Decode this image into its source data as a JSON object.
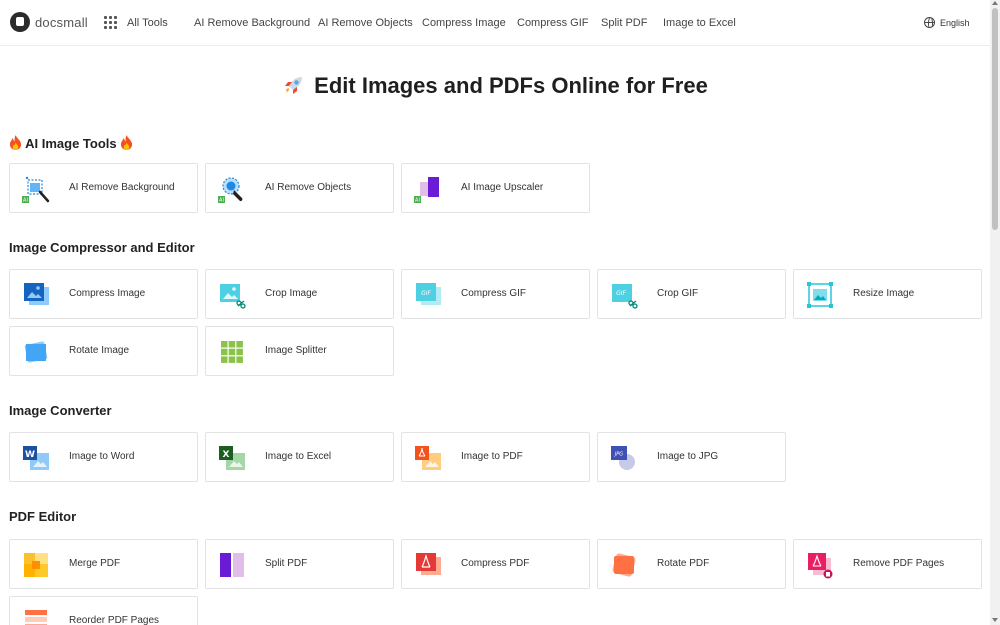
{
  "header": {
    "logo_text": "docsmall",
    "all_tools": "All Tools",
    "nav": [
      "AI Remove Background",
      "AI Remove Objects",
      "Compress Image",
      "Compress GIF",
      "Split PDF",
      "Image to Excel"
    ],
    "language": "English"
  },
  "hero": {
    "title": "Edit Images and PDFs Online for Free"
  },
  "sections": {
    "ai": {
      "title": "AI Image Tools",
      "tools": [
        "AI Remove Background",
        "AI Remove Objects",
        "AI Image Upscaler"
      ]
    },
    "compressor": {
      "title": "Image Compressor and Editor",
      "tools": [
        "Compress Image",
        "Crop Image",
        "Compress GIF",
        "Crop GIF",
        "Resize Image",
        "Rotate Image",
        "Image Splitter"
      ]
    },
    "converter": {
      "title": "Image Converter",
      "tools": [
        "Image to Word",
        "Image to Excel",
        "Image to PDF",
        "Image to JPG"
      ]
    },
    "pdf": {
      "title": "PDF Editor",
      "tools": [
        "Merge PDF",
        "Split PDF",
        "Compress PDF",
        "Rotate PDF",
        "Remove PDF Pages",
        "Reorder PDF Pages"
      ]
    }
  },
  "icon_text": {
    "ai_badge": "AI",
    "gif": "GIF",
    "word": "W",
    "excel": "X",
    "jpg": "JPG"
  }
}
